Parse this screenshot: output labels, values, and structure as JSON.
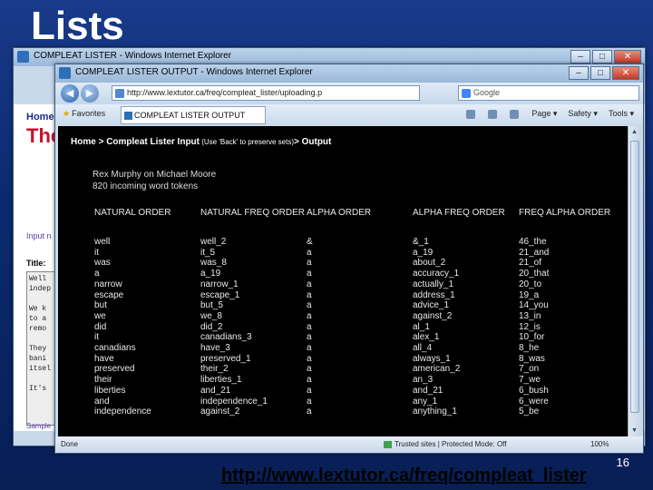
{
  "slide": {
    "title": "Lists",
    "page_number": "16",
    "url": "http://www.lextutor.ca/freq/compleat_lister"
  },
  "back_window": {
    "title": "COMPLEAT LISTER - Windows Internet Explorer",
    "home": "Home",
    "big_text": "The",
    "input_label": "Input n",
    "title_label": "Title:",
    "text_lines": [
      "Well",
      "indep",
      "",
      "We k",
      "to a",
      "remo",
      "",
      "They",
      "bani",
      "itsel",
      "",
      "It's"
    ],
    "sample": "Sample"
  },
  "front_window": {
    "title": "COMPLEAT LISTER OUTPUT - Windows Internet Explorer",
    "address": "http://www.lextutor.ca/freq/compleat_lister/uploading.p",
    "search_engine": "Google",
    "favorites": "Favorites",
    "tab_label": "COMPLEAT LISTER OUTPUT",
    "tools": [
      "Page",
      "Safety",
      "Tools"
    ],
    "status_done": "Done",
    "status_sites": "Trusted sites | Protected Mode: Off",
    "status_zoom": "100%"
  },
  "page": {
    "breadcrumb_home": "Home",
    "breadcrumb_sep1": " > ",
    "breadcrumb_input": "Compleat Lister Input",
    "breadcrumb_note": " (Use 'Back' to preserve sets)",
    "breadcrumb_sep2": "> ",
    "breadcrumb_output": "Output",
    "subtitle1": "Rex Murphy on Michael Moore",
    "subtitle2": "820 incoming word tokens",
    "columns": [
      {
        "header": "NATURAL ORDER",
        "rows": [
          "well",
          "it",
          "was",
          "a",
          "narrow",
          "escape",
          "but",
          "we",
          "did",
          "it",
          "canadians",
          "have",
          "preserved",
          "their",
          "liberties",
          "and",
          "independence"
        ]
      },
      {
        "header": "NATURAL FREQ ORDER",
        "rows": [
          "well_2",
          "it_5",
          "was_8",
          "a_19",
          "narrow_1",
          "escape_1",
          "but_5",
          "we_8",
          "did_2",
          "canadians_3",
          "have_3",
          "preserved_1",
          "their_2",
          "liberties_1",
          "and_21",
          "independence_1",
          "against_2"
        ]
      },
      {
        "header": "ALPHA ORDER",
        "rows": [
          "&",
          "a",
          "a",
          "a",
          "a",
          "a",
          "a",
          "a",
          "a",
          "a",
          "a",
          "a",
          "a",
          "a",
          "a",
          "a",
          "a"
        ]
      },
      {
        "header": "ALPHA FREQ ORDER",
        "rows": [
          "&_1",
          "a_19",
          "about_2",
          "accuracy_1",
          "actually_1",
          "address_1",
          "advice_1",
          "against_2",
          "al_1",
          "alex_1",
          "all_4",
          "always_1",
          "american_2",
          "an_3",
          "and_21",
          "any_1",
          "anything_1"
        ]
      },
      {
        "header": "FREQ ALPHA ORDER",
        "rows": [
          "46_the",
          "21_and",
          "21_of",
          "20_that",
          "20_to",
          "19_a",
          "14_you",
          "13_in",
          "12_is",
          "10_for",
          "8_he",
          "8_was",
          "7_on",
          "7_we",
          "6_bush",
          "6_were",
          "5_be"
        ]
      }
    ]
  }
}
